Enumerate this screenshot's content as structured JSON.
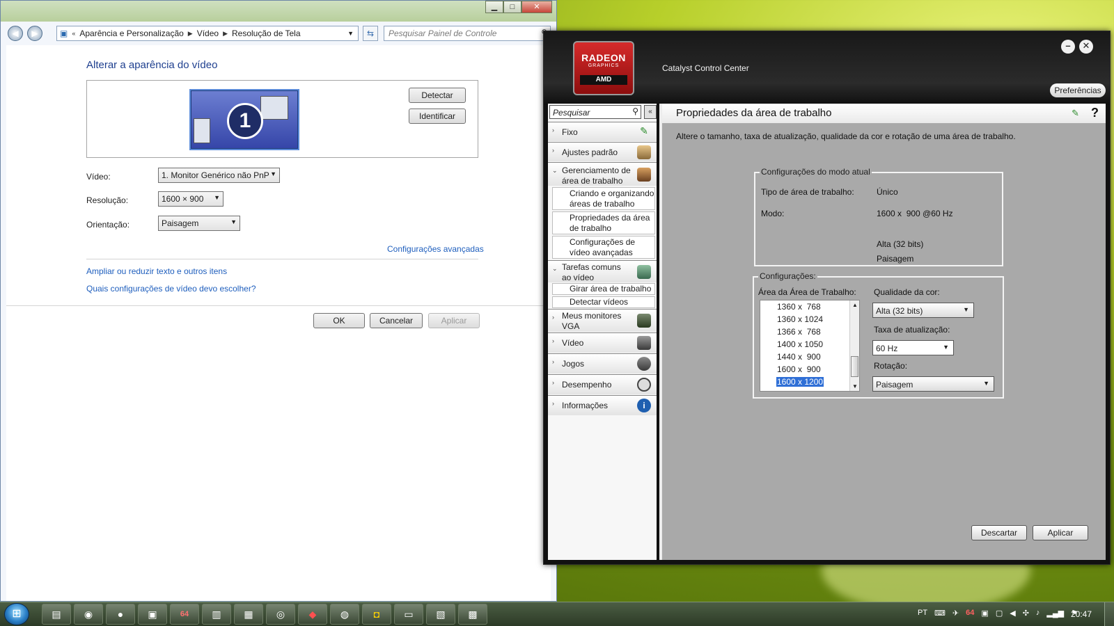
{
  "control_panel": {
    "breadcrumb": [
      "Aparência e Personalização",
      "Vídeo",
      "Resolução de Tela"
    ],
    "search_placeholder": "Pesquisar Painel de Controle",
    "title": "Alterar a aparência do vídeo",
    "monitor_number": "1",
    "detect_label": "Detectar",
    "identify_label": "Identificar",
    "video_label": "Vídeo:",
    "video_value": "1. Monitor Genérico não PnP",
    "resolution_label": "Resolução:",
    "resolution_value": "1600 × 900",
    "orientation_label": "Orientação:",
    "orientation_value": "Paisagem",
    "advanced_link": "Configurações avançadas",
    "text_size_link": "Ampliar ou reduzir texto e outros itens",
    "which_settings_link": "Quais configurações de vídeo devo escolher?",
    "ok_label": "OK",
    "cancel_label": "Cancelar",
    "apply_label": "Aplicar"
  },
  "catalyst": {
    "logo_line1": "RADEON",
    "logo_line2": "GRAPHICS",
    "logo_line3": "AMD",
    "window_title": "Catalyst Control Center",
    "preferences_label": "Preferências",
    "search_placeholder": "Pesquisar",
    "nav": {
      "fixo": "Fixo",
      "ajustes": "Ajustes padrão",
      "gerenciamento": "Gerenciamento de área de trabalho",
      "sub_criando": "Criando e organizando áreas de trabalho",
      "sub_propriedades": "Propriedades da área de trabalho",
      "sub_configuracoes": "Configurações de vídeo avançadas",
      "tarefas": "Tarefas comuns ao vídeo",
      "sub_girar": "Girar área de trabalho",
      "sub_detectar": "Detectar vídeos",
      "monitores": "Meus monitores VGA",
      "video": "Vídeo",
      "jogos": "Jogos",
      "desempenho": "Desempenho",
      "informacoes": "Informações"
    },
    "page_title": "Propriedades da área de trabalho",
    "page_desc": "Altere o tamanho, taxa de atualização, qualidade da cor e rotação de uma área de trabalho.",
    "current_mode": {
      "title": "Configurações do modo atual",
      "type_label": "Tipo de área de trabalho:",
      "type_value": "Único",
      "mode_label": "Modo:",
      "mode_value": "1600 x  900 @60 Hz",
      "color_value": "Alta (32 bits)",
      "orientation_value": "Paisagem"
    },
    "settings": {
      "title": "Configurações:",
      "area_label": "Área da Área de Trabalho:",
      "resolutions": [
        "1360 x  768",
        "1360 x 1024",
        "1366 x  768",
        "1400 x 1050",
        "1440 x  900",
        "1600 x  900",
        "1600 x 1200"
      ],
      "selected_resolution": "1600 x 1200",
      "color_quality_label": "Qualidade da cor:",
      "color_quality_value": "Alta (32 bits)",
      "refresh_label": "Taxa de atualização:",
      "refresh_value": "60 Hz",
      "rotation_label": "Rotação:",
      "rotation_value": "Paisagem"
    },
    "discard_label": "Descartar",
    "apply_label": "Aplicar"
  },
  "taskbar": {
    "language": "PT",
    "clock": "20:47",
    "badge_64": "64"
  }
}
